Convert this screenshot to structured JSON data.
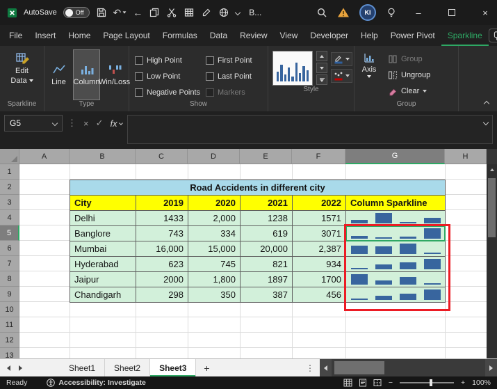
{
  "colors": {
    "accent_green": "#2EA864",
    "sparkline": "#38659E",
    "annotation_red": "#EC1C24",
    "title_fill": "#A9DAEA",
    "header_fill": "#FFFF00",
    "data_fill": "#D2F0DA"
  },
  "icons": {
    "undo": "↶",
    "back": "←",
    "dots": "⋮",
    "cancel": "×",
    "enter": "✓",
    "minimize": "–",
    "close": "×",
    "add_sheet": "+",
    "zoom_out": "−",
    "zoom_in": "+"
  },
  "titlebar": {
    "autosave_label": "AutoSave",
    "autosave_state": "Off",
    "workbook_title": "B...",
    "avatar_initials": "KI"
  },
  "menubar": {
    "tabs": [
      "File",
      "Insert",
      "Home",
      "Page Layout",
      "Formulas",
      "Data",
      "Review",
      "View",
      "Developer",
      "Help",
      "Power Pivot",
      "Sparkline"
    ],
    "active_tab": "Sparkline"
  },
  "ribbon": {
    "edit_data_line1": "Edit",
    "edit_data_line2": "Data",
    "type_buttons": [
      {
        "label": "Line"
      },
      {
        "label": "Column"
      },
      {
        "label": "Win/Loss"
      }
    ],
    "selected_type": "Column",
    "show_checkboxes": [
      {
        "label": "High Point",
        "checked": false
      },
      {
        "label": "Low Point",
        "checked": false
      },
      {
        "label": "Negative Points",
        "checked": false
      },
      {
        "label": "First Point",
        "checked": false
      },
      {
        "label": "Last Point",
        "checked": false
      },
      {
        "label": "Markers",
        "checked": false,
        "disabled": true
      }
    ],
    "axis_label": "Axis",
    "group_button": "Group",
    "ungroup_button": "Ungroup",
    "clear_button": "Clear",
    "group_names": {
      "sparkline": "Sparkline",
      "type": "Type",
      "show": "Show",
      "style": "Style",
      "group": "Group"
    }
  },
  "formula_bar": {
    "name_box": "G5",
    "fx_label": "fx",
    "formula": ""
  },
  "sheet": {
    "columns": [
      "A",
      "B",
      "C",
      "D",
      "E",
      "F",
      "G",
      "H"
    ],
    "row_numbers": [
      "1",
      "2",
      "3",
      "4",
      "5",
      "6",
      "7",
      "8",
      "9",
      "10",
      "11",
      "12",
      "13"
    ],
    "selected_column": "G",
    "selected_row": "5",
    "active_cell": "G5",
    "title_cell": "Road Accidents in different city",
    "table": {
      "headers": [
        "City",
        "2019",
        "2020",
        "2021",
        "2022",
        "Column Sparkline"
      ],
      "rows": [
        {
          "city": "Delhi",
          "values": [
            "1433",
            "2,000",
            "1238",
            "1571"
          ],
          "numbers": [
            1433,
            2000,
            1238,
            1571
          ]
        },
        {
          "city": "Banglore",
          "values": [
            "743",
            "334",
            "619",
            "3071"
          ],
          "numbers": [
            743,
            334,
            619,
            3071
          ]
        },
        {
          "city": "Mumbai",
          "values": [
            "16,000",
            "15,000",
            "20,000",
            "2,387"
          ],
          "numbers": [
            16000,
            15000,
            20000,
            2387
          ]
        },
        {
          "city": "Hyderabad",
          "values": [
            "623",
            "745",
            "821",
            "934"
          ],
          "numbers": [
            623,
            745,
            821,
            934
          ]
        },
        {
          "city": "Jaipur",
          "values": [
            "2000",
            "1,800",
            "1897",
            "1700"
          ],
          "numbers": [
            2000,
            1800,
            1897,
            1700
          ]
        },
        {
          "city": "Chandigarh",
          "values": [
            "298",
            "350",
            "387",
            "456"
          ],
          "numbers": [
            298,
            350,
            387,
            456
          ]
        }
      ]
    }
  },
  "sheet_tabs": {
    "sheets": [
      "Sheet1",
      "Sheet2",
      "Sheet3"
    ],
    "active": "Sheet3"
  },
  "status_bar": {
    "mode": "Ready",
    "accessibility": "Accessibility: Investigate",
    "zoom_level": "100%"
  }
}
